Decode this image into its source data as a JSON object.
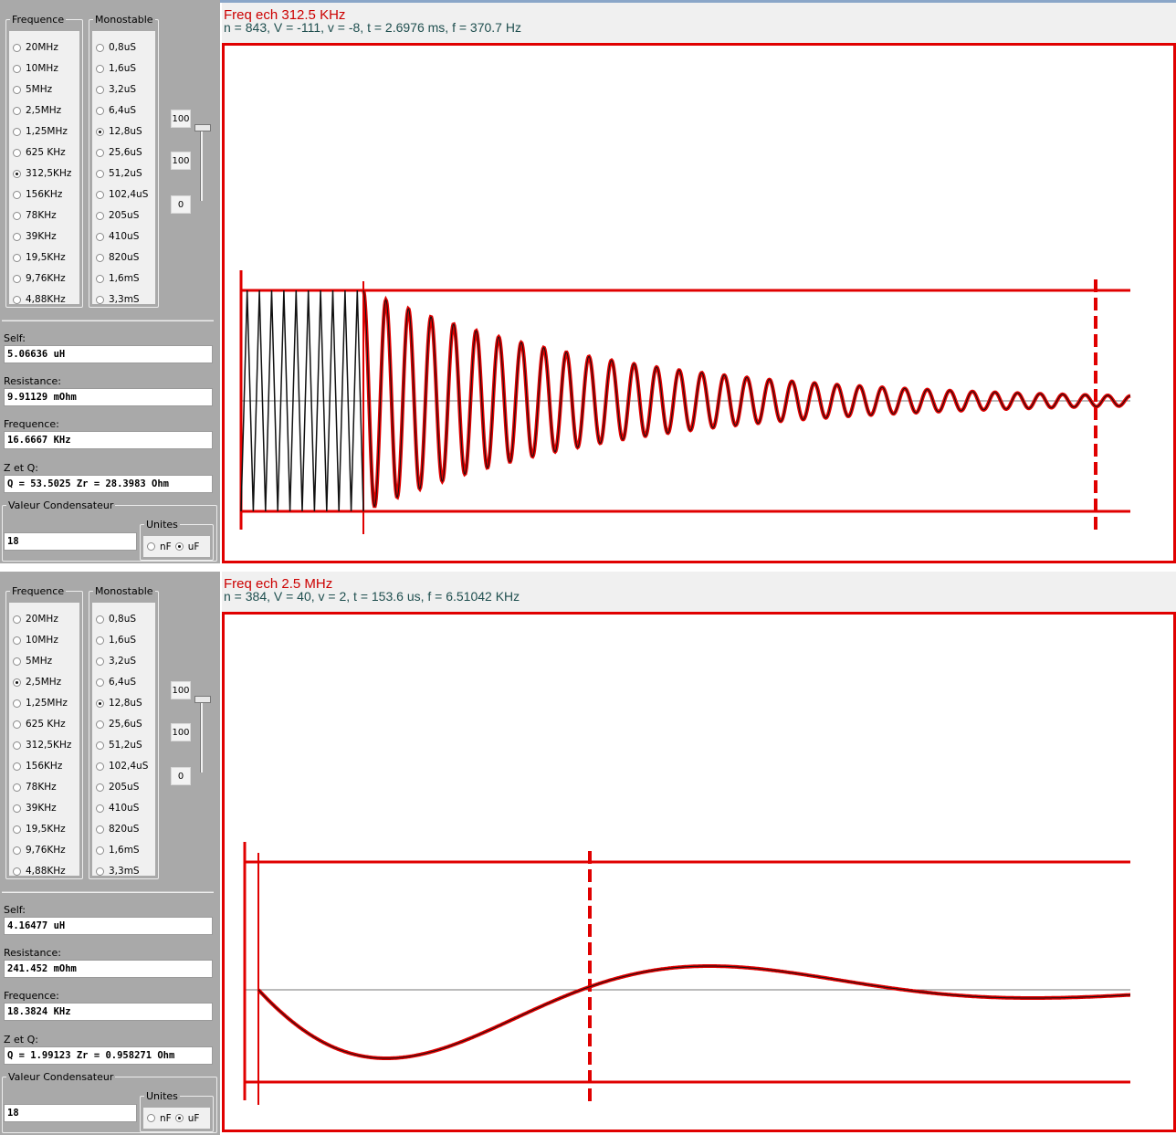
{
  "panels": [
    {
      "frequence_legend": "Frequence",
      "monostable_legend": "Monostable",
      "frequencies": [
        {
          "label": "20MHz",
          "selected": false
        },
        {
          "label": "10MHz",
          "selected": false
        },
        {
          "label": "5MHz",
          "selected": false
        },
        {
          "label": "2,5MHz",
          "selected": false
        },
        {
          "label": "1,25MHz",
          "selected": false
        },
        {
          "label": "625 KHz",
          "selected": false
        },
        {
          "label": "312,5KHz",
          "selected": true
        },
        {
          "label": "156KHz",
          "selected": false
        },
        {
          "label": "78KHz",
          "selected": false
        },
        {
          "label": "39KHz",
          "selected": false
        },
        {
          "label": "19,5KHz",
          "selected": false
        },
        {
          "label": "9,76KHz",
          "selected": false
        },
        {
          "label": "4,88KHz",
          "selected": false
        }
      ],
      "monostables": [
        {
          "label": "0,8uS",
          "selected": false
        },
        {
          "label": "1,6uS",
          "selected": false
        },
        {
          "label": "3,2uS",
          "selected": false
        },
        {
          "label": "6,4uS",
          "selected": false
        },
        {
          "label": "12,8uS",
          "selected": true
        },
        {
          "label": "25,6uS",
          "selected": false
        },
        {
          "label": "51,2uS",
          "selected": false
        },
        {
          "label": "102,4uS",
          "selected": false
        },
        {
          "label": "205uS",
          "selected": false
        },
        {
          "label": "410uS",
          "selected": false
        },
        {
          "label": "820uS",
          "selected": false
        },
        {
          "label": "1,6mS",
          "selected": false
        },
        {
          "label": "3,3mS",
          "selected": false
        }
      ],
      "level_boxes": [
        "100",
        "100",
        "0"
      ],
      "slider_level": 1.0,
      "self_label": "Self:",
      "self_value": "5.06636 uH",
      "resistance_label": "Resistance:",
      "resistance_value": "9.91129 mOhm",
      "frequence_label": "Frequence:",
      "frequence_value": "16.6667 KHz",
      "zq_label": "Z et Q:",
      "zq_value": "Q = 53.5025  Zr = 28.3983 Ohm",
      "condensateur_legend": "Valeur Condensateur",
      "condensateur_value": "18",
      "units_legend": "Unites",
      "unit_nf": "nF",
      "unit_uf": "uF",
      "unit_selected": "uF",
      "header_title": "Freq ech 312.5 KHz",
      "header_info": "n = 843, V = -111, v = -8, t = 2.6976 ms, f = 370.7 Hz",
      "plot": {
        "type": "damped",
        "cycles": 34,
        "decay": 3.1,
        "square_cycles": 10
      }
    },
    {
      "frequence_legend": "Frequence",
      "monostable_legend": "Monostable",
      "frequencies": [
        {
          "label": "20MHz",
          "selected": false
        },
        {
          "label": "10MHz",
          "selected": false
        },
        {
          "label": "5MHz",
          "selected": false
        },
        {
          "label": "2,5MHz",
          "selected": true
        },
        {
          "label": "1,25MHz",
          "selected": false
        },
        {
          "label": "625 KHz",
          "selected": false
        },
        {
          "label": "312,5KHz",
          "selected": false
        },
        {
          "label": "156KHz",
          "selected": false
        },
        {
          "label": "78KHz",
          "selected": false
        },
        {
          "label": "39KHz",
          "selected": false
        },
        {
          "label": "19,5KHz",
          "selected": false
        },
        {
          "label": "9,76KHz",
          "selected": false
        },
        {
          "label": "4,88KHz",
          "selected": false
        }
      ],
      "monostables": [
        {
          "label": "0,8uS",
          "selected": false
        },
        {
          "label": "1,6uS",
          "selected": false
        },
        {
          "label": "3,2uS",
          "selected": false
        },
        {
          "label": "6,4uS",
          "selected": false
        },
        {
          "label": "12,8uS",
          "selected": true
        },
        {
          "label": "25,6uS",
          "selected": false
        },
        {
          "label": "51,2uS",
          "selected": false
        },
        {
          "label": "102,4uS",
          "selected": false
        },
        {
          "label": "205uS",
          "selected": false
        },
        {
          "label": "410uS",
          "selected": false
        },
        {
          "label": "820uS",
          "selected": false
        },
        {
          "label": "1,6mS",
          "selected": false
        },
        {
          "label": "3,3mS",
          "selected": false
        }
      ],
      "level_boxes": [
        "100",
        "100",
        "0"
      ],
      "slider_level": 1.0,
      "self_label": "Self:",
      "self_value": "4.16477 uH",
      "resistance_label": "Resistance:",
      "resistance_value": "241.452 mOhm",
      "frequence_label": "Frequence:",
      "frequence_value": "18.3824 KHz",
      "zq_label": "Z et Q:",
      "zq_value": "Q = 1.99123  Zr = 0.958271 Ohm",
      "condensateur_legend": "Valeur Condensateur",
      "condensateur_value": "18",
      "units_legend": "Unites",
      "unit_nf": "nF",
      "unit_uf": "uF",
      "unit_selected": "uF",
      "header_title": "Freq ech 2.5 MHz",
      "header_info": "n = 384, V = 40, v = 2, t = 153.6 us, f = 6.51042 KHz",
      "plot": {
        "type": "heavy",
        "cycles": 3,
        "decay": 1.3,
        "square_cycles": 0
      }
    }
  ],
  "colors": {
    "trace": "#e00000",
    "signal": "#111111",
    "panel_bg": "#a9a9a9",
    "header_title": "#cc0000",
    "header_info": "#1f4f4f"
  }
}
